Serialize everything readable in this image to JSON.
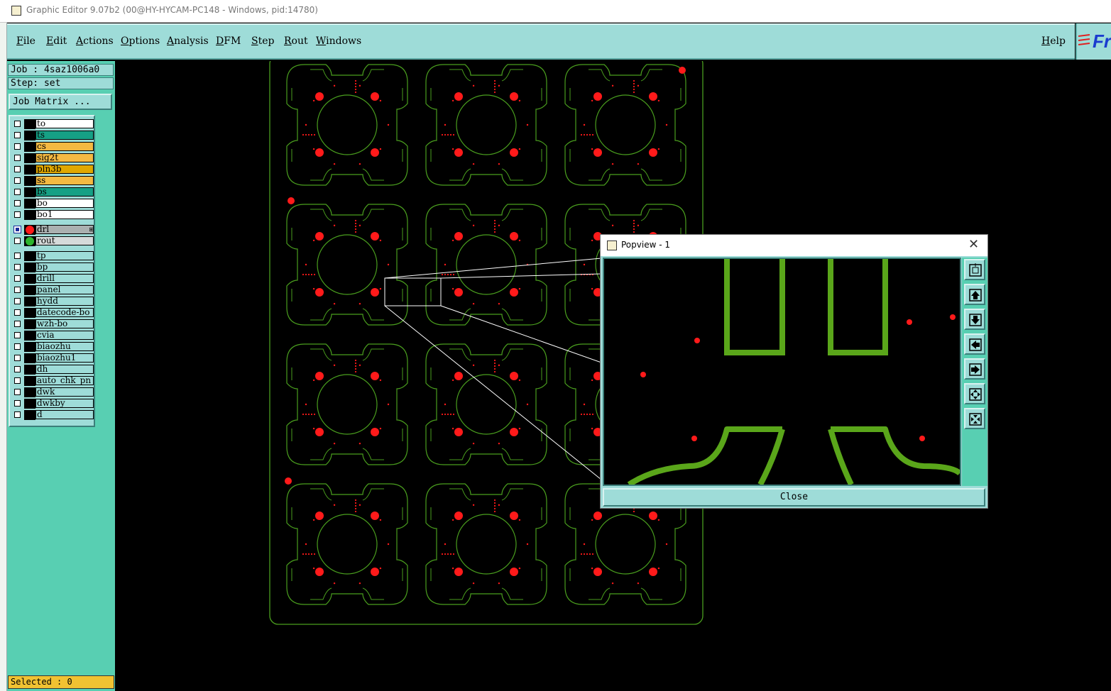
{
  "window": {
    "title": "Graphic Editor 9.07b2 (00@HY-HYCAM-PC148 - Windows, pid:14780)"
  },
  "menu": {
    "file": "File",
    "edit": "Edit",
    "actions": "Actions",
    "options": "Options",
    "analysis": "Analysis",
    "dfm": "DFM",
    "step": "Step",
    "rout": "Rout",
    "windows": "Windows",
    "help": "Help"
  },
  "brand": {
    "text": "Fr"
  },
  "job": {
    "job_label": "Job : 4saz1006a0",
    "step_label": "Step: set",
    "matrix_button": "Job Matrix ..."
  },
  "layers": {
    "board": [
      {
        "name": "to",
        "color": "#ffffff"
      },
      {
        "name": "ts",
        "color": "#16a085"
      },
      {
        "name": "cs",
        "color": "#f4b942"
      },
      {
        "name": "sig2t",
        "color": "#f4b942"
      },
      {
        "name": "pln3b",
        "color": "#e0a800"
      },
      {
        "name": "ss",
        "color": "#f4b942"
      },
      {
        "name": "bs",
        "color": "#16a085"
      },
      {
        "name": "bo",
        "color": "#ffffff"
      },
      {
        "name": "bo1",
        "color": "#ffffff"
      }
    ],
    "drill": [
      {
        "name": "drl",
        "color": "#aab0b0",
        "dot": "#ff1a1a",
        "active": true
      },
      {
        "name": "rout",
        "color": "#d6dada",
        "dot": "#2db52d",
        "active": false
      }
    ],
    "misc": [
      "tp",
      "bp",
      "drill",
      "panel",
      "hydd",
      "datecode-bo",
      "wzh-bo",
      "cvia",
      "biaozhu",
      "biaozhu1",
      "dh",
      "auto_chk_pn",
      "dwk",
      "dwkby",
      "d"
    ]
  },
  "status": {
    "selected": "Selected : 0"
  },
  "popview": {
    "title": "Popview - 1",
    "close_label": "Close"
  },
  "colors": {
    "outline": "#4a9e1e",
    "drill": "#ff1a1a",
    "panel": "#58cfb2",
    "button": "#9edcd8",
    "zoom_trace": "#5aa61a"
  }
}
